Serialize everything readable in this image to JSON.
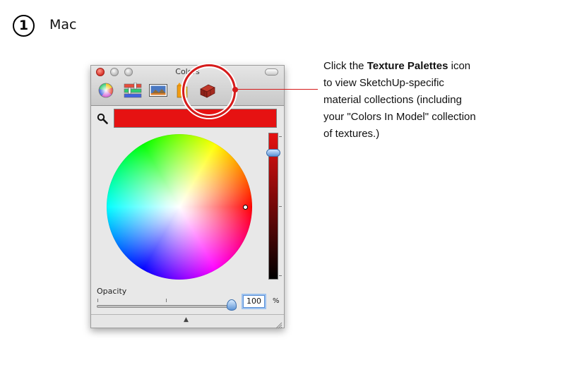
{
  "step": {
    "number": "1",
    "platform": "Mac"
  },
  "window": {
    "title": "Colors",
    "toolbar": [
      {
        "name": "color-wheel-icon"
      },
      {
        "name": "color-sliders-icon"
      },
      {
        "name": "image-palettes-icon"
      },
      {
        "name": "crayons-icon"
      },
      {
        "name": "texture-palettes-icon"
      }
    ],
    "current_color": "#e61212",
    "brightness_level": 0.87,
    "opacity": {
      "label": "Opacity",
      "value": "100",
      "unit": "%"
    }
  },
  "callout": {
    "line1_prefix": "Click the ",
    "line1_bold": "Texture Palettes",
    "line1_suffix": " icon",
    "line2": "to view SketchUp-specific",
    "line3": "material collections (including",
    "line4": "your \"Colors In Model\" collection",
    "line5": "of textures.)"
  },
  "colors": {
    "accent": "#d61b1b",
    "swatch": "#e61212"
  }
}
